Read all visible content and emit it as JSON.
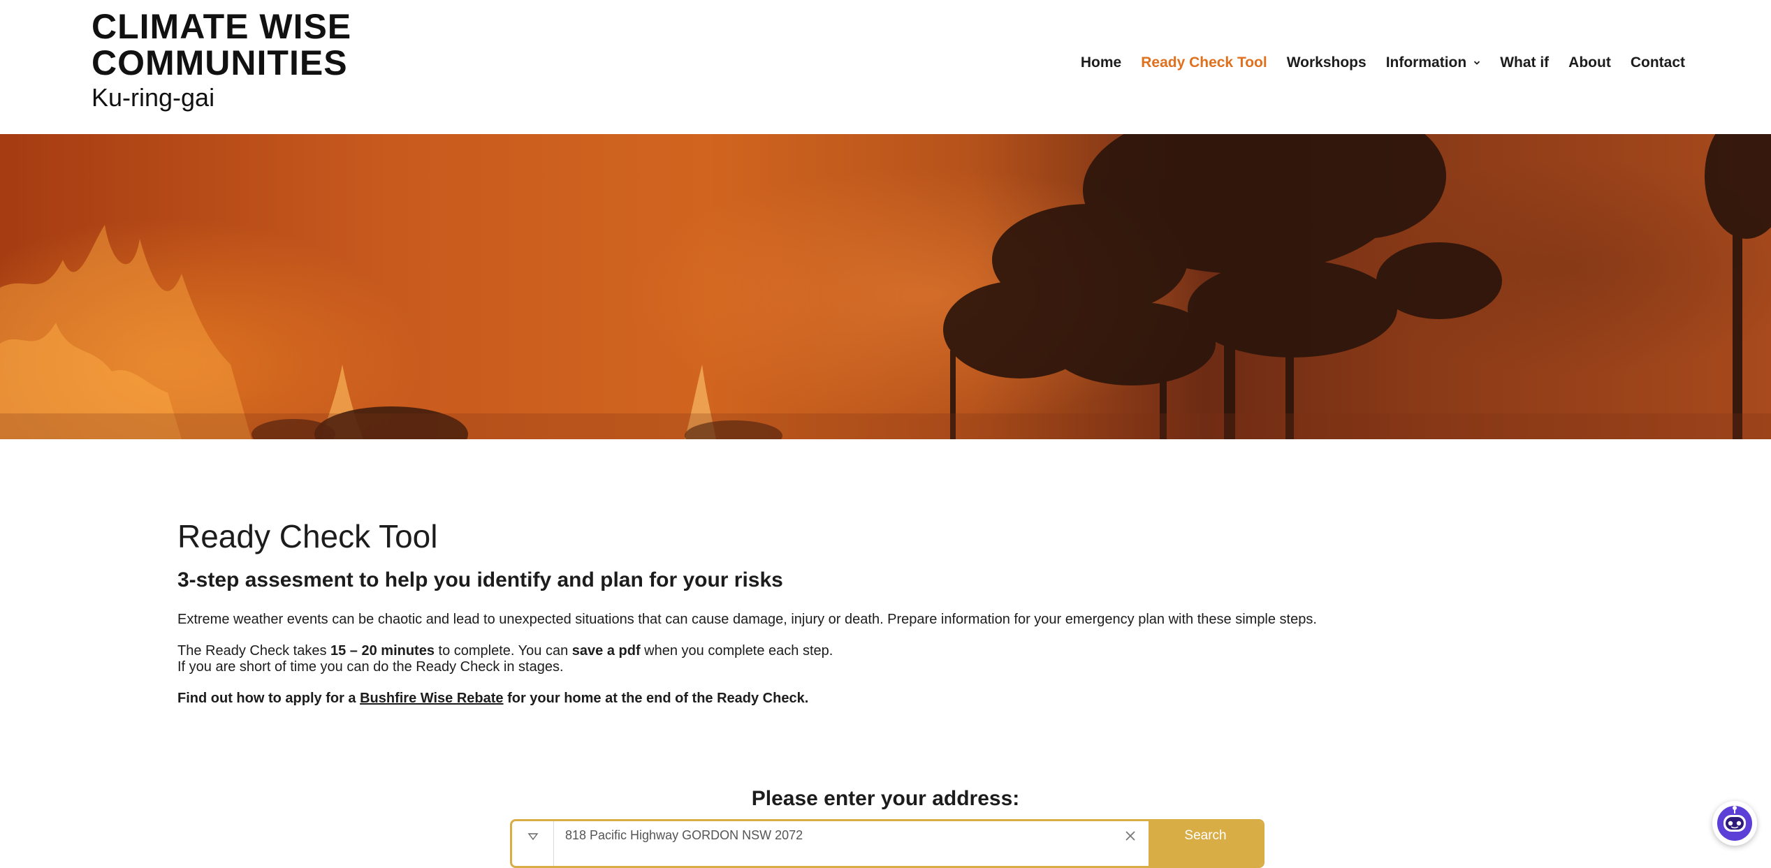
{
  "header": {
    "logo_line1": "CLIMATE WISE",
    "logo_line2": "COMMUNITIES",
    "logo_sub": "Ku-ring-gai",
    "nav": [
      {
        "label": "Home",
        "active": false
      },
      {
        "label": "Ready Check Tool",
        "active": true
      },
      {
        "label": "Workshops",
        "active": false
      },
      {
        "label": "Information",
        "active": false,
        "has_dropdown": true
      },
      {
        "label": "What if",
        "active": false
      },
      {
        "label": "About",
        "active": false
      },
      {
        "label": "Contact",
        "active": false
      }
    ],
    "accent_color": "#e0701d"
  },
  "hero": {
    "image": "bushfire-forest-photo"
  },
  "main": {
    "title": "Ready Check Tool",
    "subtitle": "3-step assesment to help you identify and plan for your risks",
    "intro": "Extreme weather events can be chaotic and lead to unexpected situations that can cause damage, injury or death. Prepare information for your emergency plan with these simple steps.",
    "time_prefix": "The Ready Check takes ",
    "time_value": "15 – 20 minutes",
    "time_middle": " to complete. You can ",
    "time_pdf": "save a pdf",
    "time_suffix": " when you complete each step.",
    "short_time": "If you are short of time you can do the Ready Check in stages.",
    "rebate_prefix": "Find out how to apply for a ",
    "rebate_link": "Bushfire Wise Rebate",
    "rebate_suffix": " for your home at the end of the Ready Check."
  },
  "address_search": {
    "label": "Please enter your address:",
    "value": "818 Pacific Highway GORDON NSW 2072",
    "button": "Search",
    "accent_color": "#d9ad45"
  },
  "chat": {
    "icon": "chatbot-icon",
    "color": "#5b3fd6"
  }
}
